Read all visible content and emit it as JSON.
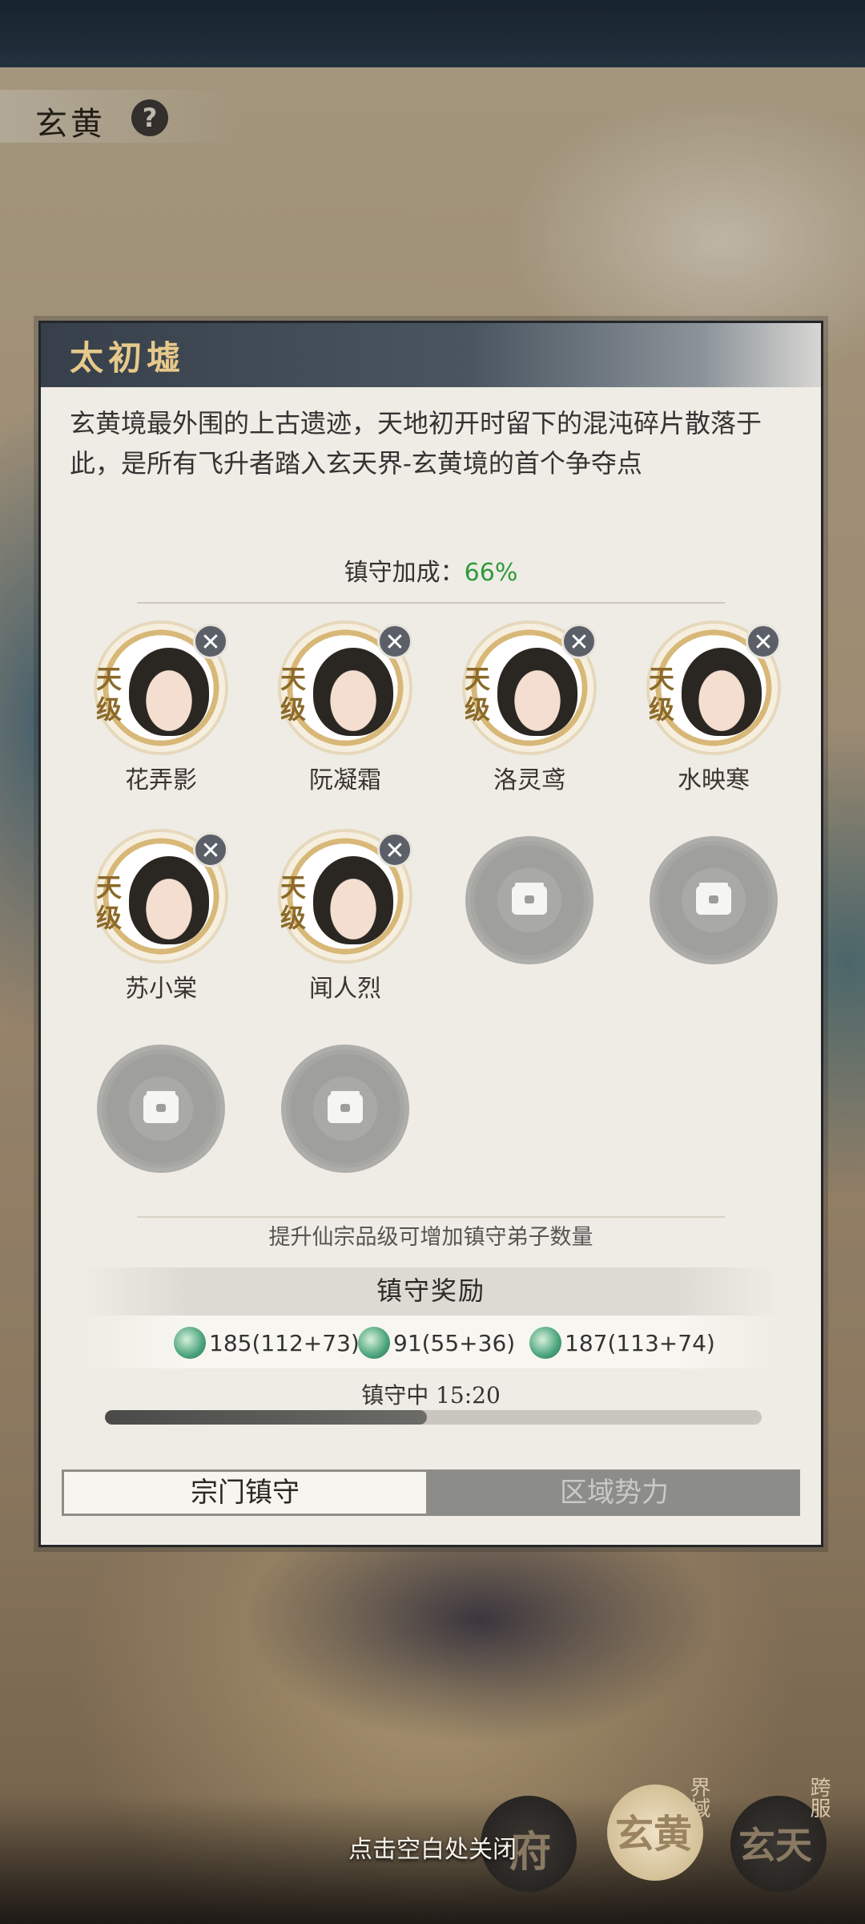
{
  "header": {
    "title": "玄黄",
    "help_icon": "question-mark-icon"
  },
  "panel": {
    "title": "太初墟",
    "description": "玄黄境最外围的上古遗迹，天地初开时留下的混沌碎片散落于此，是所有飞升者踏入玄天界-玄黄境的首个争夺点",
    "bonus_label": "镇守加成：",
    "bonus_value": "66%",
    "grade_label": "天级",
    "disciples": [
      {
        "name": "花弄影"
      },
      {
        "name": "阮凝霜"
      },
      {
        "name": "洛灵鸢"
      },
      {
        "name": "水映寒"
      },
      {
        "name": "苏小棠"
      },
      {
        "name": "闻人烈"
      }
    ],
    "remove_symbol": "✕",
    "empty_slots": 4,
    "hint": "提升仙宗品级可增加镇守弟子数量",
    "rewards_title": "镇守奖励",
    "rewards": [
      {
        "icon": "jade-plate-icon",
        "text": "185(112+73)"
      },
      {
        "icon": "spirit-gourd-icon",
        "text": "91(55+36)"
      },
      {
        "icon": "elixir-gourd-icon",
        "text": "187(113+74)"
      }
    ],
    "guard_status": "镇守中 15:20",
    "guard_progress": 0.49,
    "tabs": [
      {
        "label": "宗门镇守",
        "active": true
      },
      {
        "label": "区域势力",
        "active": false
      }
    ]
  },
  "close_hint": "点击空白处关闭",
  "bottom_nav": [
    {
      "char": "府",
      "side": ""
    },
    {
      "char": "玄黄",
      "side": "界域"
    },
    {
      "char": "玄天",
      "side": "跨服"
    }
  ]
}
